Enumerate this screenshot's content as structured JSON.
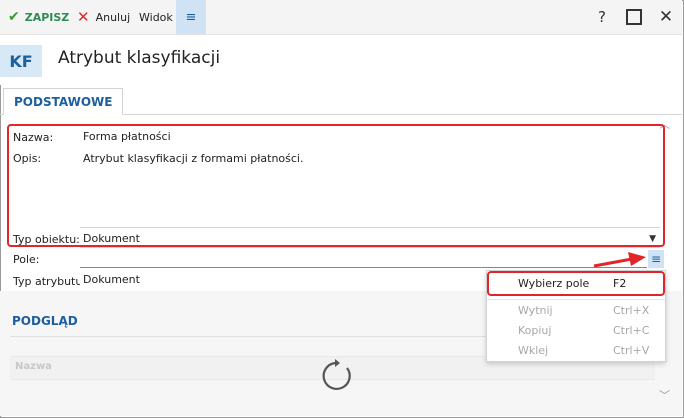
{
  "toolbar": {
    "save_label": "ZAPISZ",
    "cancel_label": "Anuluj",
    "view_label": "Widok",
    "menu_icon": "≡",
    "help_icon": "?",
    "close_icon": "✕"
  },
  "header": {
    "badge": "KF",
    "title": "Atrybut klasyfikacji"
  },
  "tabs": [
    {
      "label": "PODSTAWOWE",
      "active": true
    }
  ],
  "form": {
    "name_label": "Nazwa:",
    "name_value": "Forma płatności",
    "desc_label": "Opis:",
    "desc_value": "Atrybut klasyfikacji z formami płatności.",
    "type_label": "Typ obiektu:",
    "type_value": "Dokument",
    "field_label": "Pole:",
    "field_value": "",
    "attr_type_label": "Typ atrybutu:",
    "attr_type_value": "Dokument"
  },
  "preview": {
    "title": "PODGLĄD",
    "column_header": "Nazwa"
  },
  "context_menu": {
    "items": [
      {
        "label": "Wybierz pole",
        "shortcut": "F2",
        "enabled": true
      },
      {
        "label": "Wytnij",
        "shortcut": "Ctrl+X",
        "enabled": false
      },
      {
        "label": "Kopiuj",
        "shortcut": "Ctrl+C",
        "enabled": false
      },
      {
        "label": "Wklej",
        "shortcut": "Ctrl+V",
        "enabled": false
      }
    ]
  },
  "colors": {
    "accent": "#1d5f9e",
    "save_green": "#2e8b57",
    "cancel_red": "#d62d2d",
    "highlight_red": "#e0262b"
  }
}
